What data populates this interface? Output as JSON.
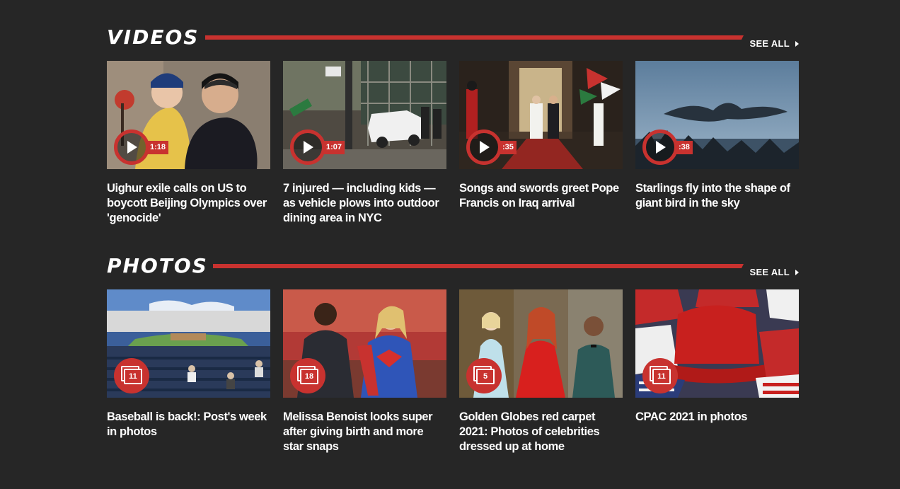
{
  "videos": {
    "title": "VIDEOS",
    "see_all": "SEE ALL",
    "items": [
      {
        "title": "Uighur exile calls on US to boycott Beijing Olympics over 'genocide'",
        "duration": "1:18"
      },
      {
        "title": "7 injured — including kids — as vehicle plows into outdoor dining area in NYC",
        "duration": "1:07"
      },
      {
        "title": "Songs and swords greet Pope Francis on Iraq arrival",
        "duration": ":35"
      },
      {
        "title": "Starlings fly into the shape of giant bird in the sky",
        "duration": ":38"
      }
    ]
  },
  "photos": {
    "title": "PHOTOS",
    "see_all": "SEE ALL",
    "items": [
      {
        "title": "Baseball is back!: Post's week in photos",
        "count": "11"
      },
      {
        "title": "Melissa Benoist looks super after giving birth and more star snaps",
        "count": "18"
      },
      {
        "title": "Golden Globes red carpet 2021: Photos of celebrities dressed up at home",
        "count": "5"
      },
      {
        "title": "CPAC 2021 in photos",
        "count": "11"
      }
    ]
  },
  "theme": {
    "accent": "#c8322f",
    "background": "#262626",
    "text": "#ffffff"
  }
}
